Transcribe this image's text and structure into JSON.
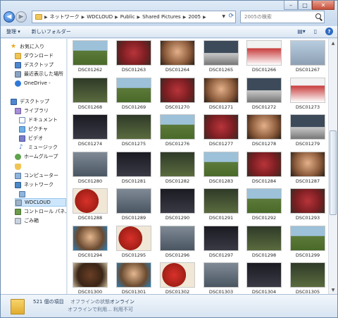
{
  "window": {
    "controls": {
      "minimize": "–",
      "maximize": "□",
      "close": "✕"
    }
  },
  "address": {
    "crumbs": [
      "ネットワーク",
      "WDCLOUD",
      "Public",
      "Shared Pictures",
      "2005"
    ]
  },
  "search": {
    "placeholder": "2005の検索"
  },
  "toolbar": {
    "organize": "整理 ▾",
    "new_folder": "新しいフォルダー"
  },
  "nav": {
    "favorites": "お気に入り",
    "downloads": "ダウンロード",
    "desktop_fav": "デスクトップ",
    "recent": "最近表示した場所",
    "onedrive": "OneDrive -",
    "desktop": "デスクトップ",
    "libraries": "ライブラリ",
    "documents": "ドキュメント",
    "pictures": "ピクチャ",
    "videos": "ビデオ",
    "music": "ミュージック",
    "homegroup": "ホームグループ",
    "computer": "コンピューター",
    "network": "ネットワーク",
    "wdcloud": "WDCLOUD",
    "control_panel": "コントロール パネル",
    "recycle": "ごみ箱"
  },
  "files": [
    "DSC01262",
    "DSC01263",
    "DSC01264",
    "DSC01265",
    "DSC01266",
    "DSC01267",
    "DSC01268",
    "DSC01269",
    "DSC01270",
    "DSC01271",
    "DSC01272",
    "DSC01273",
    "DSC01274",
    "DSC01275",
    "DSC01276",
    "DSC01277",
    "DSC01278",
    "DSC01279",
    "DSC01280",
    "DSC01281",
    "DSC01282",
    "DSC01283",
    "DSC01284",
    "DSC01287",
    "DSC01288",
    "DSC01289",
    "DSC01290",
    "DSC01291",
    "DSC01292",
    "DSC01293",
    "DSC01294",
    "DSC01295",
    "DSC01296",
    "DSC01297",
    "DSC01298",
    "DSC01299",
    "DSC01300",
    "DSC01301",
    "DSC01302",
    "DSC01303",
    "DSC01304",
    "DSC01305"
  ],
  "details": {
    "count": "521 個の項目",
    "status_label": "オフラインの状態:",
    "status_value": "オンライン",
    "offline": "オフラインで利用... 利用不可"
  }
}
